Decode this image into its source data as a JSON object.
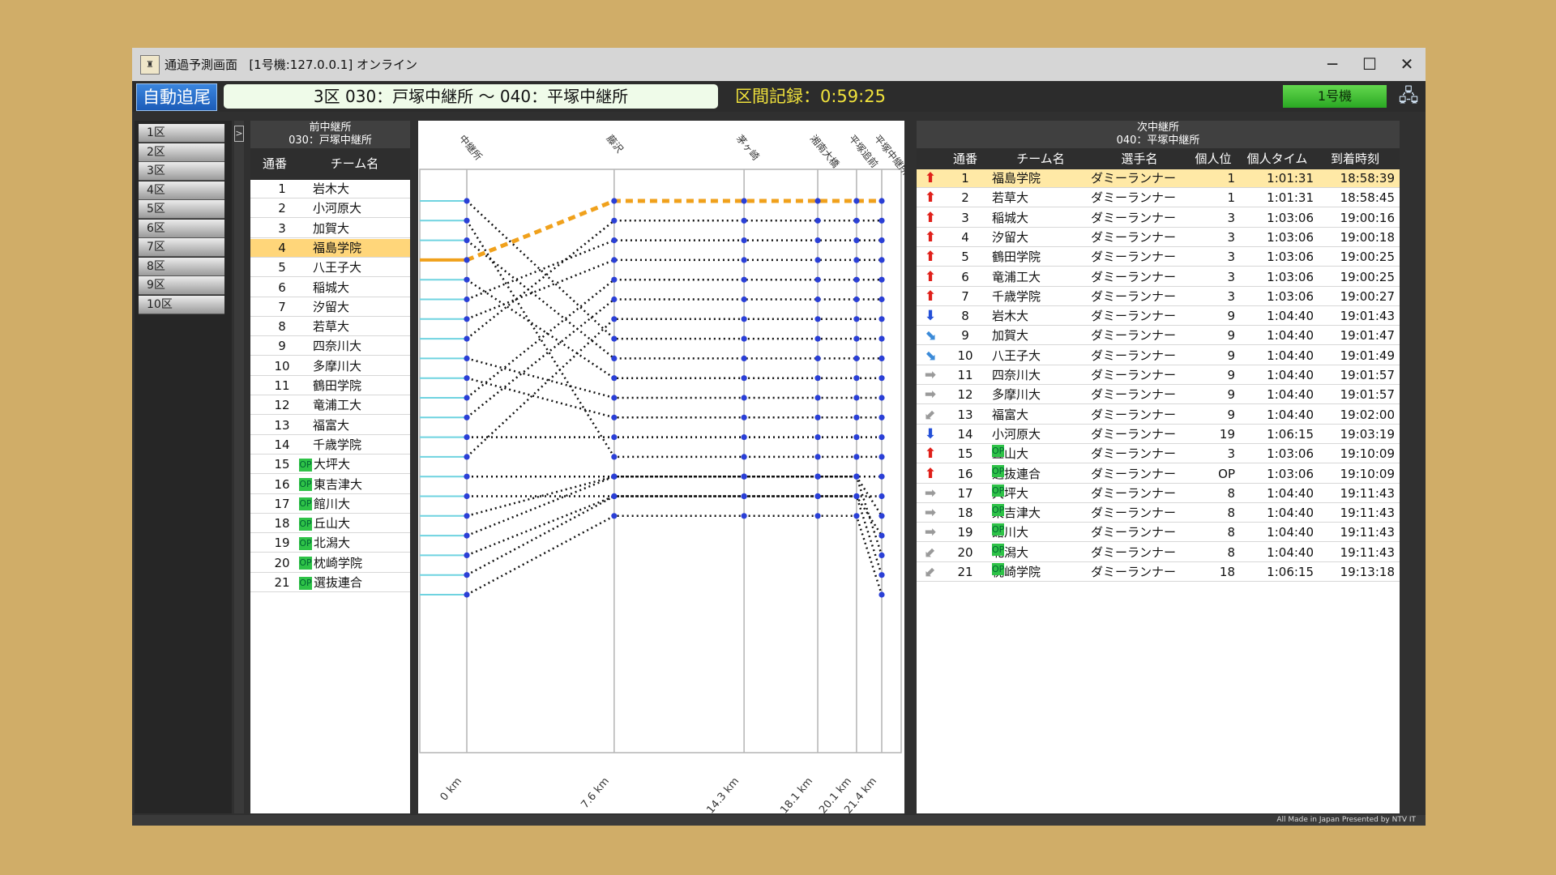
{
  "window": {
    "title": "通過予測画面",
    "connection": "[1号機:127.0.0.1] オンライン",
    "minimize": "─",
    "maximize": "☐",
    "close": "✕"
  },
  "toolbar": {
    "auto_follow": "自動追尾",
    "section": "3区 030：戸塚中継所 ～ 040：平塚中継所",
    "record": "区間記録：0:59:25",
    "unit": "1号機",
    "network_icon": "network-icon"
  },
  "sections": [
    "1区",
    "2区",
    "3区",
    "4区",
    "5区",
    "6区",
    "7区",
    "8区",
    "9区",
    "10区"
  ],
  "collapse_label": ">",
  "prev_panel": {
    "header": "前中継所",
    "station": "030：戸塚中継所",
    "col_no": "通番",
    "col_team": "チーム名",
    "rows": [
      {
        "no": "1",
        "team": "岩木大",
        "op": false
      },
      {
        "no": "2",
        "team": "小河原大",
        "op": false
      },
      {
        "no": "3",
        "team": "加賀大",
        "op": false
      },
      {
        "no": "4",
        "team": "福島学院",
        "op": false,
        "highlight": true
      },
      {
        "no": "5",
        "team": "八王子大",
        "op": false
      },
      {
        "no": "6",
        "team": "稲城大",
        "op": false
      },
      {
        "no": "7",
        "team": "汐留大",
        "op": false
      },
      {
        "no": "8",
        "team": "若草大",
        "op": false
      },
      {
        "no": "9",
        "team": "四奈川大",
        "op": false
      },
      {
        "no": "10",
        "team": "多摩川大",
        "op": false
      },
      {
        "no": "11",
        "team": "鶴田学院",
        "op": false
      },
      {
        "no": "12",
        "team": "竜浦工大",
        "op": false
      },
      {
        "no": "13",
        "team": "福富大",
        "op": false
      },
      {
        "no": "14",
        "team": "千歳学院",
        "op": false
      },
      {
        "no": "15",
        "team": "大坪大",
        "op": true
      },
      {
        "no": "16",
        "team": "東吉津大",
        "op": true
      },
      {
        "no": "17",
        "team": "館川大",
        "op": true
      },
      {
        "no": "18",
        "team": "丘山大",
        "op": true
      },
      {
        "no": "19",
        "team": "北潟大",
        "op": true
      },
      {
        "no": "20",
        "team": "枕崎学院",
        "op": true
      },
      {
        "no": "21",
        "team": "選抜連合",
        "op": true
      }
    ]
  },
  "chart_data": {
    "type": "line",
    "title": "",
    "points": [
      {
        "label": "中継所",
        "km": "0 km"
      },
      {
        "label": "藤沢",
        "km": "7.6 km"
      },
      {
        "label": "茅ヶ崎",
        "km": "14.3 km"
      },
      {
        "label": "湘南大橋",
        "km": "18.1 km"
      },
      {
        "label": "平塚追前",
        "km": "20.1 km"
      },
      {
        "label": "平塚中継所",
        "km": "21.4 km"
      }
    ],
    "x": [
      0,
      7.6,
      14.3,
      18.1,
      20.1,
      21.4
    ],
    "highlight_team": 4,
    "highlight_color": "#f0a11c",
    "positions": [
      [
        1,
        8,
        8,
        8,
        8,
        8
      ],
      [
        2,
        14,
        14,
        14,
        14,
        14
      ],
      [
        3,
        9,
        9,
        9,
        9,
        9
      ],
      [
        4,
        1,
        1,
        1,
        1,
        1
      ],
      [
        5,
        10,
        10,
        10,
        10,
        10
      ],
      [
        6,
        3,
        3,
        3,
        3,
        3
      ],
      [
        7,
        4,
        4,
        4,
        4,
        4
      ],
      [
        8,
        2,
        2,
        2,
        2,
        2
      ],
      [
        9,
        11,
        11,
        11,
        11,
        11
      ],
      [
        10,
        12,
        12,
        12,
        12,
        12
      ],
      [
        11,
        5,
        5,
        5,
        5,
        5
      ],
      [
        12,
        6,
        6,
        6,
        6,
        6
      ],
      [
        13,
        13,
        13,
        13,
        13,
        13
      ],
      [
        14,
        7,
        7,
        7,
        7,
        7
      ],
      [
        15,
        15,
        15,
        15,
        15,
        17
      ],
      [
        16,
        16,
        16,
        16,
        16,
        18
      ],
      [
        17,
        15,
        15,
        15,
        15,
        19
      ],
      [
        18,
        15,
        15,
        15,
        15,
        15
      ],
      [
        19,
        16,
        16,
        16,
        16,
        20
      ],
      [
        20,
        16,
        16,
        16,
        16,
        16
      ],
      [
        21,
        17,
        17,
        17,
        17,
        21
      ]
    ]
  },
  "next_panel": {
    "header": "次中継所",
    "station": "040：平塚中継所",
    "cols": {
      "no": "通番",
      "team": "チーム名",
      "runner": "選手名",
      "prank": "個人位",
      "ptime": "個人タイム",
      "arrive": "到着時刻"
    },
    "rows": [
      {
        "dir": "up",
        "no": "1",
        "team": "福島学院",
        "op": false,
        "runner": "ダミーランナー",
        "prank": "1",
        "ptime": "1:01:31",
        "arrive": "18:58:39",
        "highlight": true
      },
      {
        "dir": "up",
        "no": "2",
        "team": "若草大",
        "op": false,
        "runner": "ダミーランナー",
        "prank": "1",
        "ptime": "1:01:31",
        "arrive": "18:58:45"
      },
      {
        "dir": "up",
        "no": "3",
        "team": "稲城大",
        "op": false,
        "runner": "ダミーランナー",
        "prank": "3",
        "ptime": "1:03:06",
        "arrive": "19:00:16"
      },
      {
        "dir": "up",
        "no": "4",
        "team": "汐留大",
        "op": false,
        "runner": "ダミーランナー",
        "prank": "3",
        "ptime": "1:03:06",
        "arrive": "19:00:18"
      },
      {
        "dir": "up",
        "no": "5",
        "team": "鶴田学院",
        "op": false,
        "runner": "ダミーランナー",
        "prank": "3",
        "ptime": "1:03:06",
        "arrive": "19:00:25"
      },
      {
        "dir": "up",
        "no": "6",
        "team": "竜浦工大",
        "op": false,
        "runner": "ダミーランナー",
        "prank": "3",
        "ptime": "1:03:06",
        "arrive": "19:00:25"
      },
      {
        "dir": "up",
        "no": "7",
        "team": "千歳学院",
        "op": false,
        "runner": "ダミーランナー",
        "prank": "3",
        "ptime": "1:03:06",
        "arrive": "19:00:27"
      },
      {
        "dir": "down",
        "no": "8",
        "team": "岩木大",
        "op": false,
        "runner": "ダミーランナー",
        "prank": "9",
        "ptime": "1:04:40",
        "arrive": "19:01:43"
      },
      {
        "dir": "slightdown",
        "no": "9",
        "team": "加賀大",
        "op": false,
        "runner": "ダミーランナー",
        "prank": "9",
        "ptime": "1:04:40",
        "arrive": "19:01:47"
      },
      {
        "dir": "slightdown",
        "no": "10",
        "team": "八王子大",
        "op": false,
        "runner": "ダミーランナー",
        "prank": "9",
        "ptime": "1:04:40",
        "arrive": "19:01:49"
      },
      {
        "dir": "flat",
        "no": "11",
        "team": "四奈川大",
        "op": false,
        "runner": "ダミーランナー",
        "prank": "9",
        "ptime": "1:04:40",
        "arrive": "19:01:57"
      },
      {
        "dir": "flat",
        "no": "12",
        "team": "多摩川大",
        "op": false,
        "runner": "ダミーランナー",
        "prank": "9",
        "ptime": "1:04:40",
        "arrive": "19:01:57"
      },
      {
        "dir": "slightup",
        "no": "13",
        "team": "福富大",
        "op": false,
        "runner": "ダミーランナー",
        "prank": "9",
        "ptime": "1:04:40",
        "arrive": "19:02:00"
      },
      {
        "dir": "down",
        "no": "14",
        "team": "小河原大",
        "op": false,
        "runner": "ダミーランナー",
        "prank": "19",
        "ptime": "1:06:15",
        "arrive": "19:03:19"
      },
      {
        "dir": "up",
        "no": "15",
        "team": "丘山大",
        "op": true,
        "runner": "ダミーランナー",
        "prank": "3",
        "ptime": "1:03:06",
        "arrive": "19:10:09"
      },
      {
        "dir": "up",
        "no": "16",
        "team": "選抜連合",
        "op": true,
        "runner": "ダミーランナー",
        "prank": "OP",
        "ptime": "1:03:06",
        "arrive": "19:10:09"
      },
      {
        "dir": "flat",
        "no": "17",
        "team": "大坪大",
        "op": true,
        "runner": "ダミーランナー",
        "prank": "8",
        "ptime": "1:04:40",
        "arrive": "19:11:43"
      },
      {
        "dir": "flat",
        "no": "18",
        "team": "東吉津大",
        "op": true,
        "runner": "ダミーランナー",
        "prank": "8",
        "ptime": "1:04:40",
        "arrive": "19:11:43"
      },
      {
        "dir": "flat",
        "no": "19",
        "team": "館川大",
        "op": true,
        "runner": "ダミーランナー",
        "prank": "8",
        "ptime": "1:04:40",
        "arrive": "19:11:43"
      },
      {
        "dir": "slightup",
        "no": "20",
        "team": "北潟大",
        "op": true,
        "runner": "ダミーランナー",
        "prank": "8",
        "ptime": "1:04:40",
        "arrive": "19:11:43"
      },
      {
        "dir": "slightup",
        "no": "21",
        "team": "枕崎学院",
        "op": true,
        "runner": "ダミーランナー",
        "prank": "18",
        "ptime": "1:06:15",
        "arrive": "19:13:18"
      }
    ]
  },
  "op_badge": "OP",
  "status_text": "All Made in Japan  Presented by NTV IT"
}
